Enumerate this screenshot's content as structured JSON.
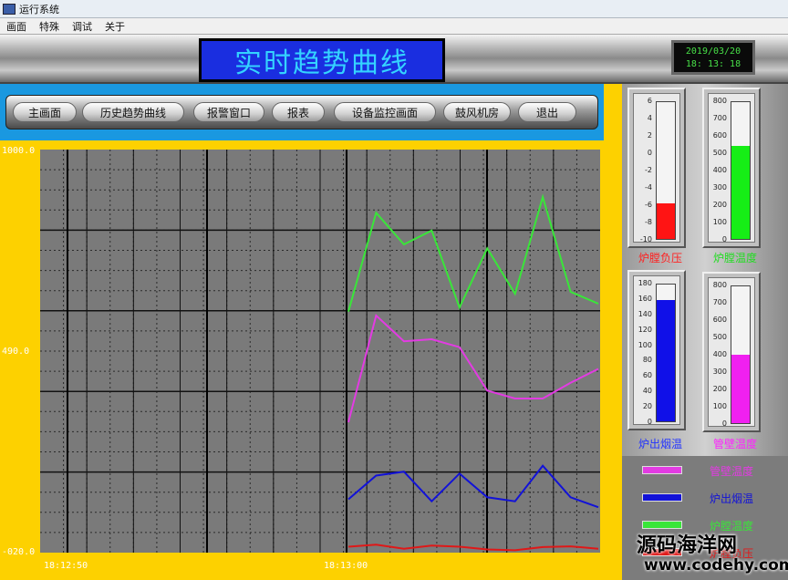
{
  "window": {
    "title": "运行系统"
  },
  "menu": [
    "画面",
    "特殊",
    "调试",
    "关于"
  ],
  "header": {
    "title": "实时趋势曲线",
    "clock_date": "2019/03/20",
    "clock_time": "18: 13: 18"
  },
  "nav": [
    "主画面",
    "历史趋势曲线",
    "报警窗口",
    "报表",
    "设备监控画面",
    "鼓风机房",
    "退出"
  ],
  "chart_data": {
    "type": "line",
    "ylim": [
      -20,
      1000
    ],
    "y_tick_labels": [
      "1000.0",
      "490.0",
      "-020.0"
    ],
    "x_tick_labels": [
      "18:12:50",
      "18:13:00"
    ],
    "grid": true,
    "x_sample_indices": [
      0,
      1,
      2,
      3,
      4,
      5,
      6,
      7,
      8,
      9,
      10
    ],
    "series": [
      {
        "name": "炉膛温度",
        "color": "#39e639",
        "values": [
          590,
          840,
          760,
          795,
          600,
          750,
          635,
          880,
          640,
          610
        ]
      },
      {
        "name": "管壁温度",
        "color": "#e33be3",
        "values": [
          310,
          580,
          515,
          520,
          500,
          390,
          370,
          370,
          410,
          445
        ]
      },
      {
        "name": "炉出烟温",
        "color": "#1212d8",
        "values": [
          115,
          175,
          185,
          110,
          180,
          120,
          110,
          200,
          120,
          95
        ]
      },
      {
        "name": "炉膛负压",
        "color": "#e01818",
        "values": [
          -5,
          0,
          -10,
          -2,
          -5,
          -12,
          -14,
          -6,
          -4,
          -10
        ]
      }
    ]
  },
  "gauges": [
    {
      "label": "炉膛负压",
      "label_color": "#ff2020",
      "ticks": [
        "6",
        "4",
        "2",
        "0",
        "-2",
        "-4",
        "-6",
        "-8",
        "-10"
      ],
      "fill_fraction": 0.26,
      "fill_color": "#ff1414"
    },
    {
      "label": "炉膛温度",
      "label_color": "#22dd22",
      "ticks": [
        "800",
        "700",
        "600",
        "500",
        "400",
        "300",
        "200",
        "100",
        "0"
      ],
      "fill_fraction": 0.68,
      "fill_color": "#16ee16"
    },
    {
      "label": "炉出烟温",
      "label_color": "#2233ff",
      "ticks": [
        "180",
        "160",
        "140",
        "120",
        "100",
        "80",
        "60",
        "40",
        "20",
        "0"
      ],
      "fill_fraction": 0.89,
      "fill_color": "#1010e8"
    },
    {
      "label": "管壁温度",
      "label_color": "#ff22ff",
      "ticks": [
        "800",
        "700",
        "600",
        "500",
        "400",
        "300",
        "200",
        "100",
        "0"
      ],
      "fill_fraction": 0.5,
      "fill_color": "#f020f0"
    }
  ],
  "legend": [
    {
      "name": "管壁温度",
      "color": "#e33be3"
    },
    {
      "name": "炉出烟温",
      "color": "#1212d8"
    },
    {
      "name": "炉膛温度",
      "color": "#39e639"
    },
    {
      "name": "炉膛负压",
      "color": "#e01818"
    }
  ],
  "watermark": {
    "line1": "源码海洋网",
    "line2": "www.codehy.com"
  }
}
